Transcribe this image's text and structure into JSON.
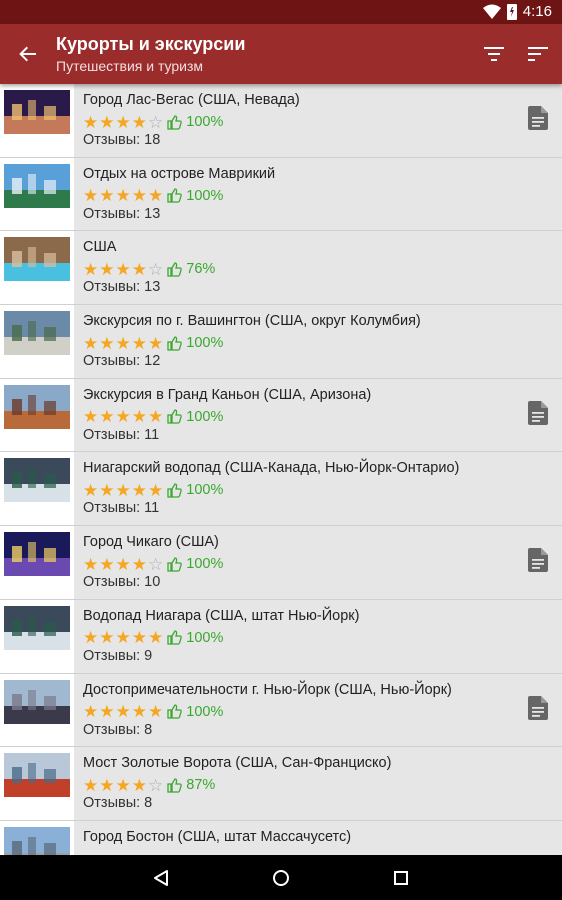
{
  "status_bar": {
    "time": "4:16"
  },
  "app_bar": {
    "title": "Курорты и экскурсии",
    "subtitle": "Путешествия и туризм"
  },
  "list": {
    "reviews_prefix": "Отзывы: ",
    "items": [
      {
        "title": "Город Лас-Вегас (США, Невада)",
        "stars": 4,
        "percent": "100%",
        "reviews": "Отзывы: 18",
        "has_doc": true,
        "thumb": "city-night-icon"
      },
      {
        "title": "Отдых на острове Маврикий",
        "stars": 5,
        "percent": "100%",
        "reviews": "Отзывы: 13",
        "has_doc": false,
        "thumb": "island-icon"
      },
      {
        "title": "США",
        "stars": 4,
        "percent": "76%",
        "reviews": "Отзывы: 13",
        "has_doc": false,
        "thumb": "pool-icon"
      },
      {
        "title": "Экскурсия по г. Вашингтон (США, округ Колумбия)",
        "stars": 5,
        "percent": "100%",
        "reviews": "Отзывы: 12",
        "has_doc": false,
        "thumb": "capitol-icon"
      },
      {
        "title": "Экскурсия в Гранд Каньон (США, Аризона)",
        "stars": 5,
        "percent": "100%",
        "reviews": "Отзывы: 11",
        "has_doc": true,
        "thumb": "canyon-icon"
      },
      {
        "title": "Ниагарский водопад (США-Канада, Нью-Йорк-Онтарио)",
        "stars": 5,
        "percent": "100%",
        "reviews": "Отзывы: 11",
        "has_doc": false,
        "thumb": "waterfall-icon"
      },
      {
        "title": "Город Чикаго (США)",
        "stars": 4,
        "percent": "100%",
        "reviews": "Отзывы: 10",
        "has_doc": true,
        "thumb": "skyline-night-icon"
      },
      {
        "title": "Водопад Ниагара (США, штат Нью-Йорк)",
        "stars": 5,
        "percent": "100%",
        "reviews": "Отзывы: 9",
        "has_doc": false,
        "thumb": "waterfall-icon"
      },
      {
        "title": "Достопримечательности г. Нью-Йорк (США, Нью-Йорк)",
        "stars": 5,
        "percent": "100%",
        "reviews": "Отзывы: 8",
        "has_doc": true,
        "thumb": "skyline-icon"
      },
      {
        "title": "Мост Золотые Ворота (США, Сан-Франциско)",
        "stars": 4,
        "percent": "87%",
        "reviews": "Отзывы: 8",
        "has_doc": false,
        "thumb": "bridge-icon"
      },
      {
        "title": "Город Бостон (США, штат Массачусетс)",
        "stars": 0,
        "percent": "",
        "reviews": "",
        "has_doc": false,
        "thumb": "city-icon"
      }
    ]
  },
  "colors": {
    "app_bar": "#9b2c2c",
    "status_bar": "#6e1414",
    "star": "#f5a623",
    "percent": "#3aa82f"
  }
}
